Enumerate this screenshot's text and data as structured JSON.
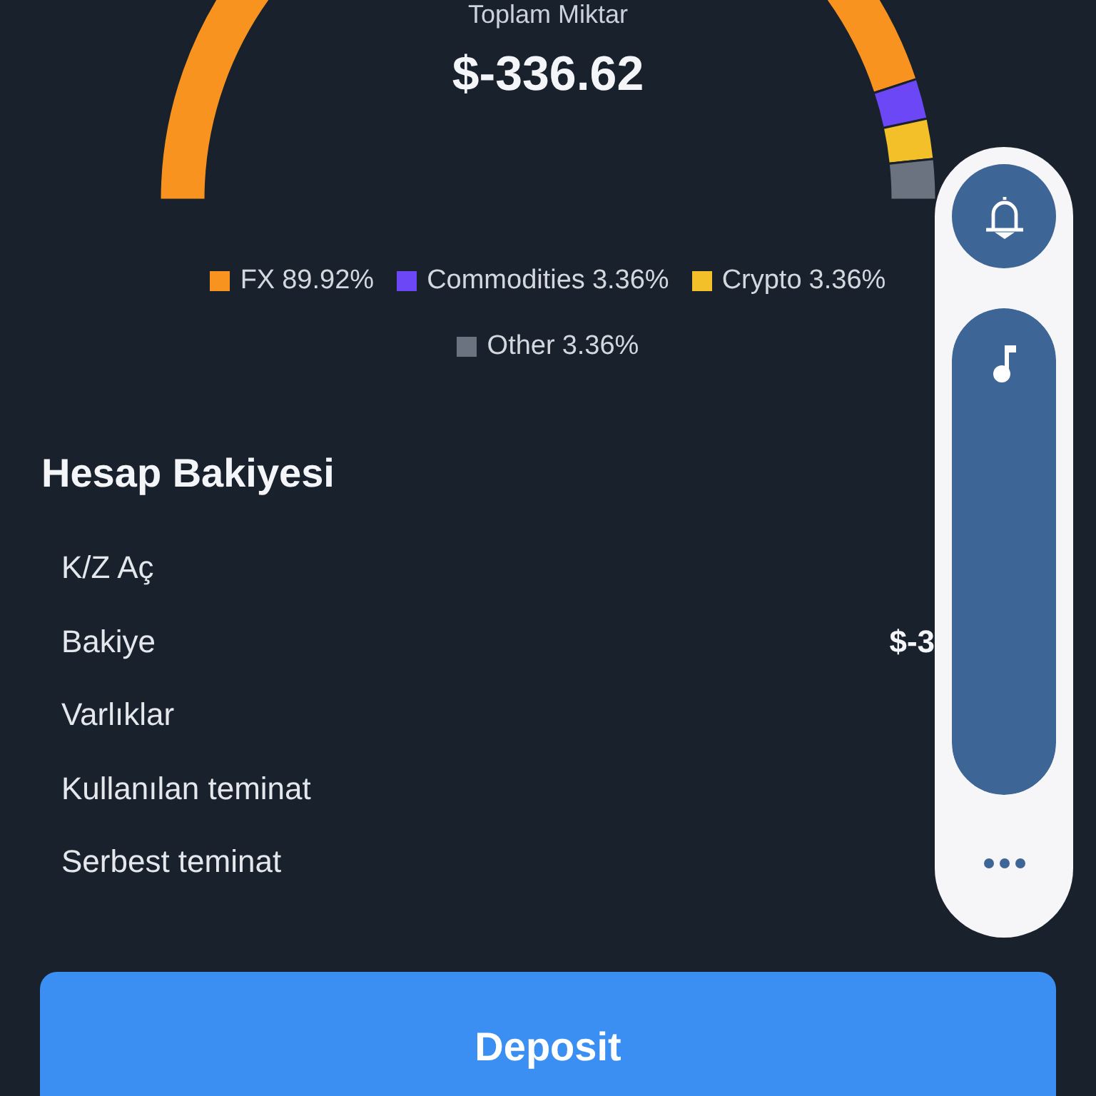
{
  "summary": {
    "title": "Toplam Miktar",
    "amount": "$-336.62",
    "chart_data": {
      "type": "donut",
      "categories": [
        "FX",
        "Commodities",
        "Crypto",
        "Other"
      ],
      "values": [
        89.92,
        3.36,
        3.36,
        3.36
      ],
      "value_labels": [
        "89.92%",
        "3.36%",
        "3.36%",
        "3.36%"
      ],
      "colors": [
        "#f7931e",
        "#6c47f5",
        "#f4c02a",
        "#6b7280"
      ]
    }
  },
  "balance": {
    "title": "Hesap Bakiyesi",
    "rows": [
      {
        "label": "K/Z Aç"
      },
      {
        "label": "Bakiye",
        "value": "$-3"
      },
      {
        "label": "Varlıklar"
      },
      {
        "label": "Kullanılan teminat"
      },
      {
        "label": "Serbest teminat"
      }
    ]
  },
  "deposit_button": "Deposit",
  "volume_panel": {
    "level": 1
  }
}
